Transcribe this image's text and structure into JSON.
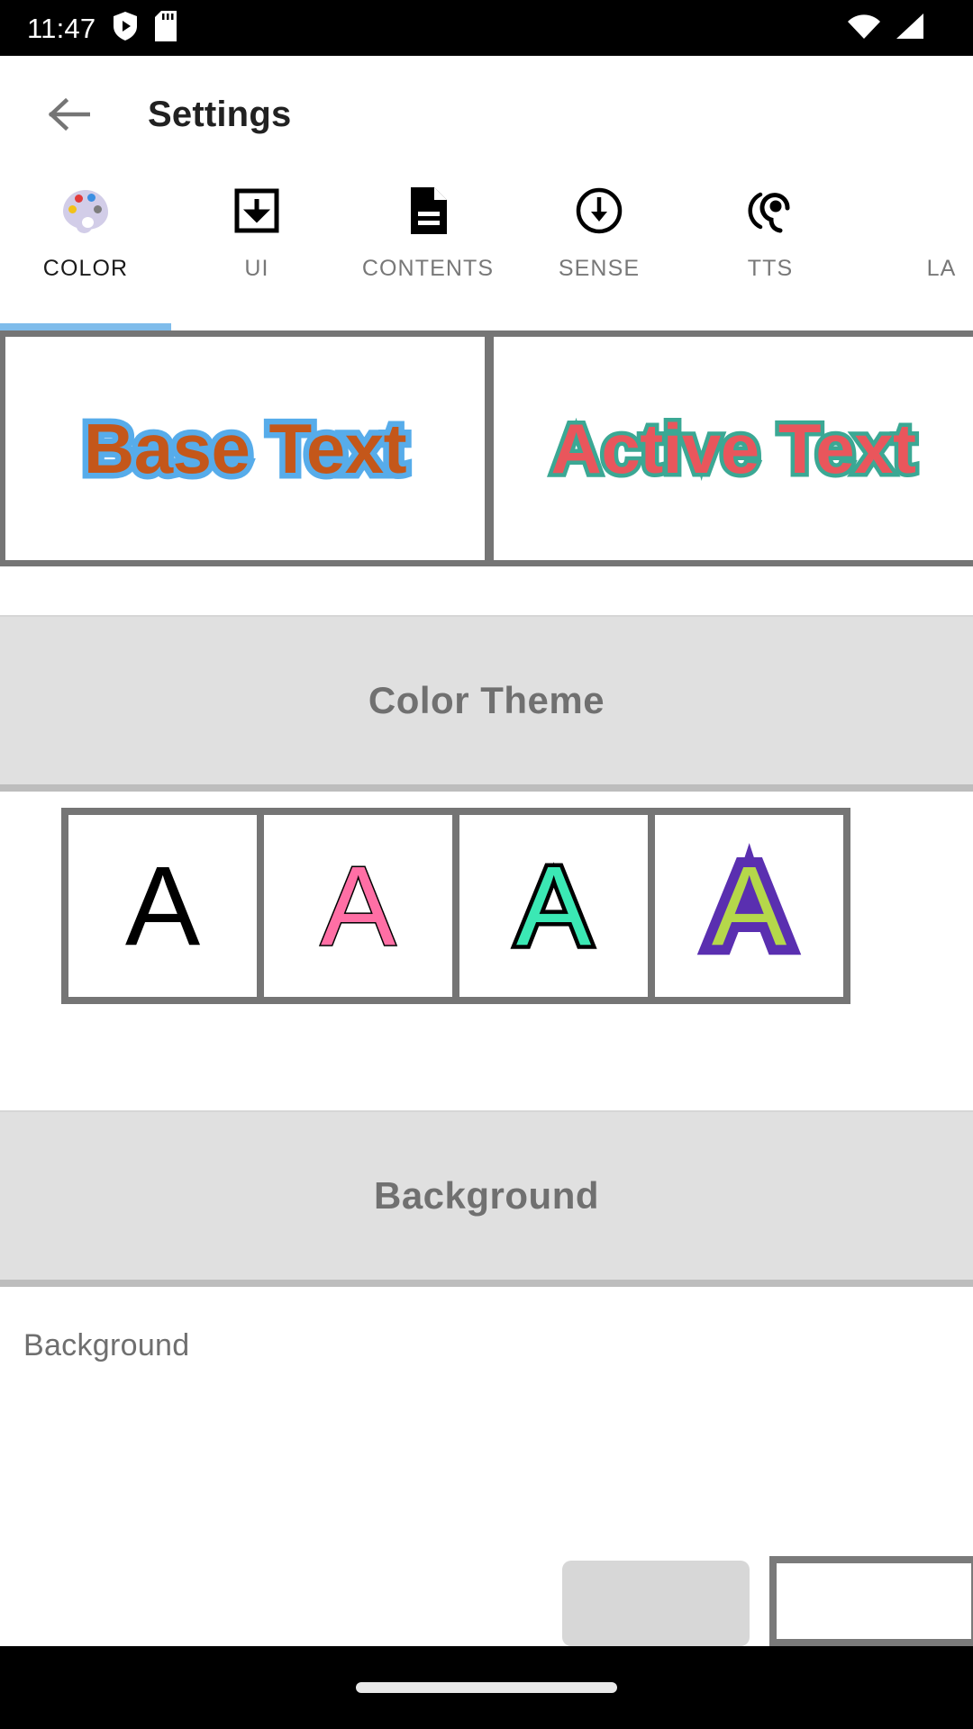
{
  "status_bar": {
    "time": "11:47",
    "left_icons": [
      "shield-play-icon",
      "sd-card-icon"
    ],
    "right_icons": [
      "wifi-icon",
      "cellular-signal-icon"
    ]
  },
  "app_bar": {
    "back_icon": "arrow-left-icon",
    "title": "Settings"
  },
  "tabs": {
    "active_index": 0,
    "indicator_color": "#7FBCEB",
    "items": [
      {
        "label": "COLOR",
        "icon": "palette-icon"
      },
      {
        "label": "UI",
        "icon": "download-box-icon"
      },
      {
        "label": "CONTENTS",
        "icon": "document-icon"
      },
      {
        "label": "SENSE",
        "icon": "circle-down-arrow-icon"
      },
      {
        "label": "TTS",
        "icon": "hearing-ear-icon"
      },
      {
        "label": "LA",
        "icon": ""
      }
    ]
  },
  "preview": {
    "base": {
      "text": "Base Text",
      "fill_color": "#C4571A",
      "outline_color": "#57ACEA"
    },
    "active": {
      "text": "Active Text",
      "fill_color": "#E9565C",
      "outline_color": "#3BA894"
    },
    "container_color": "#757575"
  },
  "color_theme_section": {
    "title": "Color Theme",
    "swatches": [
      {
        "letter": "A",
        "fill_color": "#000000",
        "outline_color": "#000000"
      },
      {
        "letter": "A",
        "fill_color": "#FF6FA5",
        "outline_color": "#000000"
      },
      {
        "letter": "A",
        "fill_color": "#3BE8B4",
        "outline_color": "#000000"
      },
      {
        "letter": "A",
        "fill_color": "#B5D84A",
        "outline_color": "#5A2FB0"
      }
    ]
  },
  "background_section": {
    "title": "Background",
    "row_label": "Background",
    "swatch_button_color": "#D7D7D7",
    "preview_border_color": "#7a7a7a"
  },
  "nav_bar": {
    "handle": "gesture-home-pill"
  }
}
